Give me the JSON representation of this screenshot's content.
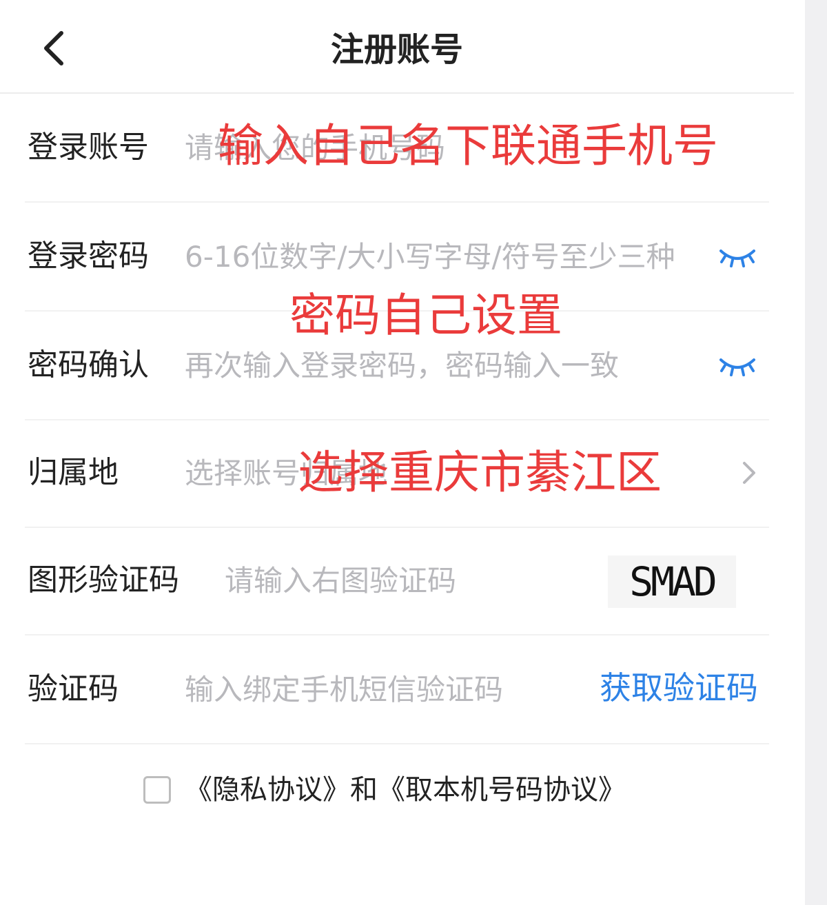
{
  "header": {
    "title": "注册账号",
    "back_icon": "chevron-left-icon"
  },
  "form": {
    "account": {
      "label": "登录账号",
      "placeholder": "请输入您的手机号码",
      "annotation": "输入自己名下联通手机号"
    },
    "password": {
      "label": "登录密码",
      "placeholder": "6-16位数字/大小写字母/符号至少三种",
      "annotation": "密码自己设置",
      "toggle_icon": "eye-closed-icon"
    },
    "confirm": {
      "label": "密码确认",
      "placeholder": "再次输入登录密码，密码输入一致",
      "toggle_icon": "eye-closed-icon"
    },
    "region": {
      "label": "归属地",
      "placeholder": "选择账号归属地",
      "annotation": "选择重庆市綦江区",
      "chevron_icon": "chevron-right-icon"
    },
    "captcha": {
      "label": "图形验证码",
      "placeholder": "请输入右图验证码",
      "image_text": "SMAD"
    },
    "sms": {
      "label": "验证码",
      "placeholder": "输入绑定手机短信验证码",
      "button_label": "获取验证码"
    }
  },
  "agreement": {
    "text": "《隐私协议》和《取本机号码协议》",
    "checked": false
  },
  "colors": {
    "annotation": "#ea3b3b",
    "accent": "#2d82e6",
    "placeholder": "#b8b8bc",
    "text": "#222222"
  }
}
